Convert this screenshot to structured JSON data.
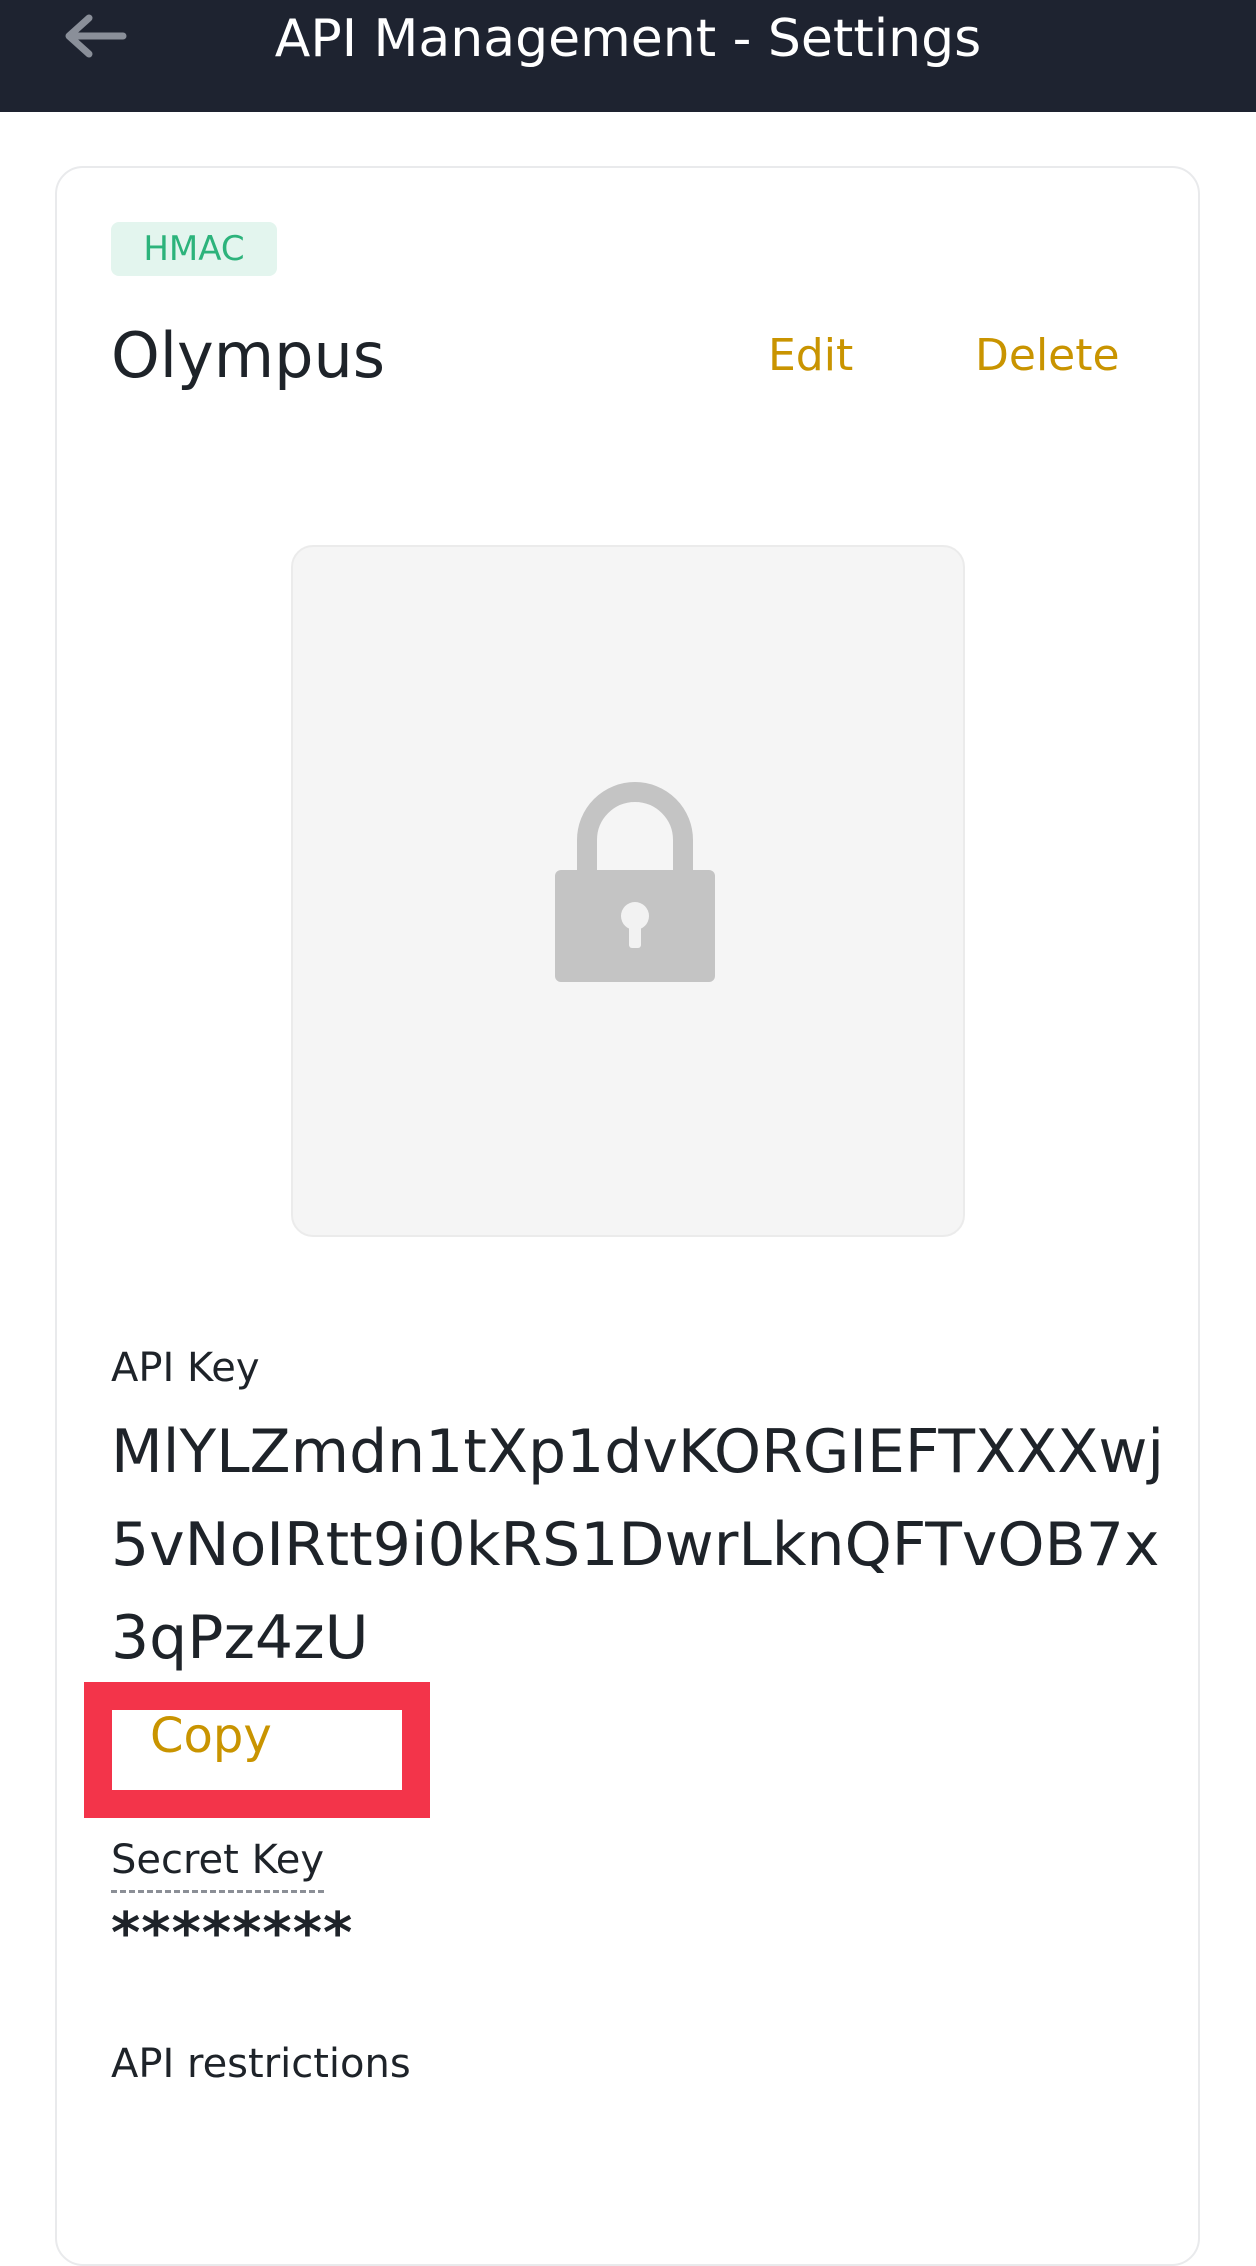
{
  "header": {
    "title": "API Management - Settings"
  },
  "api_key_card": {
    "badge": "HMAC",
    "name": "Olympus",
    "edit_label": "Edit",
    "delete_label": "Delete",
    "api_key_label": "API Key",
    "api_key_value": "MlYLZmdn1tXp1dvKORGIEFTXXXwj5vNoIRtt9i0kRS1DwrLknQFTvOB7x3qPz4zU",
    "copy_label": "Copy",
    "secret_key_label": "Secret Key",
    "secret_key_value": "********",
    "restrictions_label": "API restrictions"
  },
  "colors": {
    "header_bg": "#1e2330",
    "accent": "#c99400",
    "badge_text": "#2cb37b",
    "badge_bg": "#e3f5ee",
    "highlight": "#f3344a"
  },
  "icons": {
    "back": "arrow-left-icon",
    "lock": "lock-icon"
  }
}
